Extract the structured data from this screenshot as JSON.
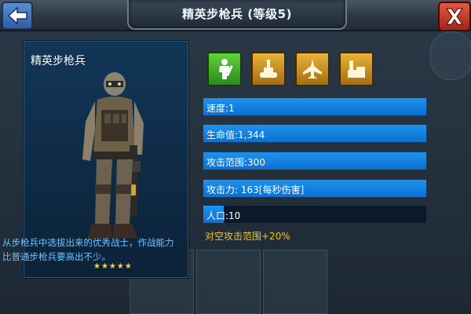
{
  "header": {
    "title": "精英步枪兵 (等级5)",
    "back_icon": "back-arrow-icon",
    "close_icon": "close-x-icon"
  },
  "unit": {
    "name": "精英步枪兵",
    "stars": "★★★★★",
    "star_count": 5,
    "description": "从步枪兵中选拔出来的优秀战士，作战能力比普通步枪兵要高出不少。"
  },
  "categories": [
    {
      "icon": "infantry-icon",
      "active": true
    },
    {
      "icon": "tank-icon",
      "active": false
    },
    {
      "icon": "aircraft-icon",
      "active": false
    },
    {
      "icon": "building-icon",
      "active": false
    }
  ],
  "stats": {
    "speed": "速度:1",
    "health": "生命值:1,344",
    "range": "攻击范围:300",
    "attack": "攻击力: 163[每秒伤害]",
    "population": "人口:10",
    "population_fill_percent": 9
  },
  "bonus": "对空攻击范围+20%",
  "colors": {
    "stat_bar": "#1d93f0",
    "bonus_text": "#f2c230",
    "description_text": "#6ec3ff",
    "active_icon": "#3faa24",
    "inactive_icon": "#d49a24"
  }
}
